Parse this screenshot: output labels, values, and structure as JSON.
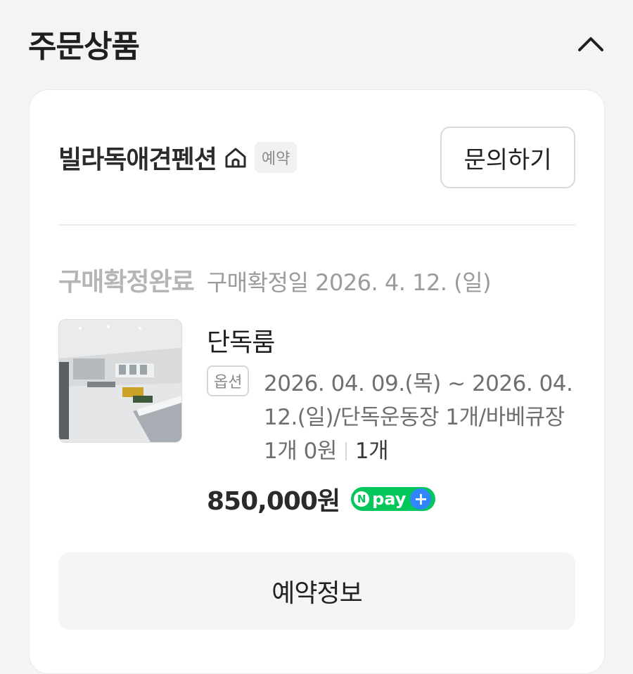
{
  "header": {
    "title": "주문상품",
    "collapse_icon": "chevron-up-icon"
  },
  "shop": {
    "name": "빌라독애견펜션",
    "home_icon": "home-icon",
    "badge": "예약",
    "inquiry_label": "문의하기"
  },
  "status": {
    "label": "구매확정완료",
    "date_text": "구매확정일 2026. 4. 12. (일)"
  },
  "product": {
    "image_icon": "room-photo",
    "name": "단독룸",
    "option_badge": "옵션",
    "option_detail": "2026. 04. 09.(목) ~ 2026. 04. 12.(일)/단독운동장 1개/바베큐장 1개 0원",
    "quantity": "1개",
    "price": "850,000원",
    "payment": {
      "n_label": "N",
      "pay_label": "pay",
      "plus_label": "+",
      "color_green": "#03c75a",
      "color_blue": "#2f86ff"
    }
  },
  "actions": {
    "reservation_info_label": "예약정보"
  }
}
